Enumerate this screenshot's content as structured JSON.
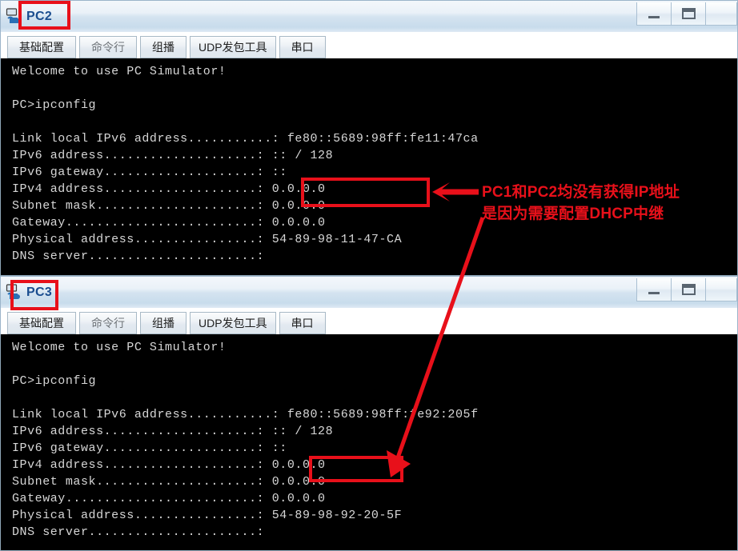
{
  "windows": [
    {
      "title": "PC2",
      "icon": "pc-simulator-icon",
      "controls": {
        "minimize": "–",
        "maximize": "□"
      },
      "tabs": [
        {
          "label": "基础配置",
          "active": true
        },
        {
          "label": "命令行",
          "active": false
        },
        {
          "label": "组播",
          "active": false
        },
        {
          "label": "UDP发包工具",
          "active": false
        },
        {
          "label": "串口",
          "active": false
        }
      ],
      "terminal_lines": [
        "Welcome to use PC Simulator!",
        "",
        "PC>ipconfig",
        "",
        "Link local IPv6 address...........: fe80::5689:98ff:fe11:47ca",
        "IPv6 address....................: :: / 128",
        "IPv6 gateway....................: ::",
        "IPv4 address....................: 0.0.0.0",
        "Subnet mask.....................: 0.0.0.0",
        "Gateway.........................: 0.0.0.0",
        "Physical address................: 54-89-98-11-47-CA",
        "DNS server......................:"
      ]
    },
    {
      "title": "PC3",
      "icon": "pc-simulator-icon",
      "controls": {
        "minimize": "–",
        "maximize": "□"
      },
      "tabs": [
        {
          "label": "基础配置",
          "active": true
        },
        {
          "label": "命令行",
          "active": false
        },
        {
          "label": "组播",
          "active": false
        },
        {
          "label": "UDP发包工具",
          "active": false
        },
        {
          "label": "串口",
          "active": false
        }
      ],
      "terminal_lines": [
        "Welcome to use PC Simulator!",
        "",
        "PC>ipconfig",
        "",
        "Link local IPv6 address...........: fe80::5689:98ff:fe92:205f",
        "IPv6 address....................: :: / 128",
        "IPv6 gateway....................: ::",
        "IPv4 address....................: 0.0.0.0",
        "Subnet mask.....................: 0.0.0.0",
        "Gateway.........................: 0.0.0.0",
        "Physical address................: 54-89-98-92-20-5F",
        "DNS server......................:"
      ]
    }
  ],
  "annotations": {
    "color": "#e8101a",
    "note_line1": "PC1和PC2均没有获得IP地址",
    "note_line2": "是因为需要配置DHCP中继"
  }
}
